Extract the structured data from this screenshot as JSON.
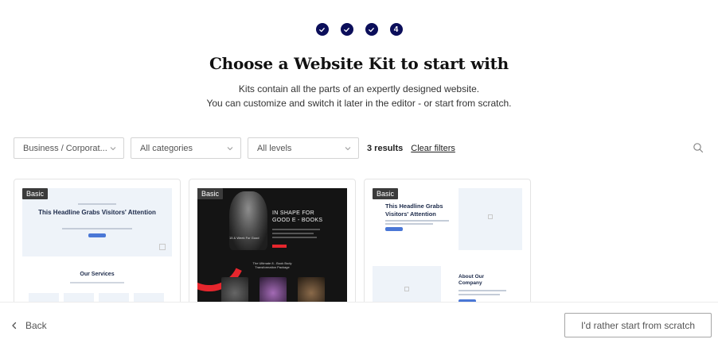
{
  "stepper": {
    "steps": [
      {
        "state": "done",
        "icon": "check-icon"
      },
      {
        "state": "done",
        "icon": "check-icon"
      },
      {
        "state": "done",
        "icon": "check-icon"
      },
      {
        "state": "current",
        "label": "4"
      }
    ],
    "color": "#0b0e5a"
  },
  "header": {
    "title": "Choose a Website Kit to start with",
    "subtitle_line1": "Kits contain all the parts of an expertly designed website.",
    "subtitle_line2": "You can customize and switch it later in the editor - or start from scratch."
  },
  "filters": {
    "type_select": "Business / Corporat...",
    "category_select": "All categories",
    "level_select": "All levels",
    "results": "3 results",
    "clear_label": "Clear filters",
    "search_icon": "search-icon"
  },
  "kits": [
    {
      "badge": "Basic",
      "preview": {
        "headline": "This Headline Grabs Visitors' Attention",
        "section": "Our Services"
      }
    },
    {
      "badge": "Basic",
      "preview": {
        "headline": "IN SHAPE FOR GOOD E - BOOKS",
        "figure_caption": "15 & Week For Good",
        "mid_text": "The Ultimate 8 - Book Body Transformation Package",
        "accent": "#e6262d"
      }
    },
    {
      "badge": "Basic",
      "preview": {
        "headline": "This Headline Grabs Visitors' Attention",
        "section": "About Our Company"
      }
    }
  ],
  "footer": {
    "back_label": "Back",
    "scratch_label": "I'd rather start from scratch"
  }
}
